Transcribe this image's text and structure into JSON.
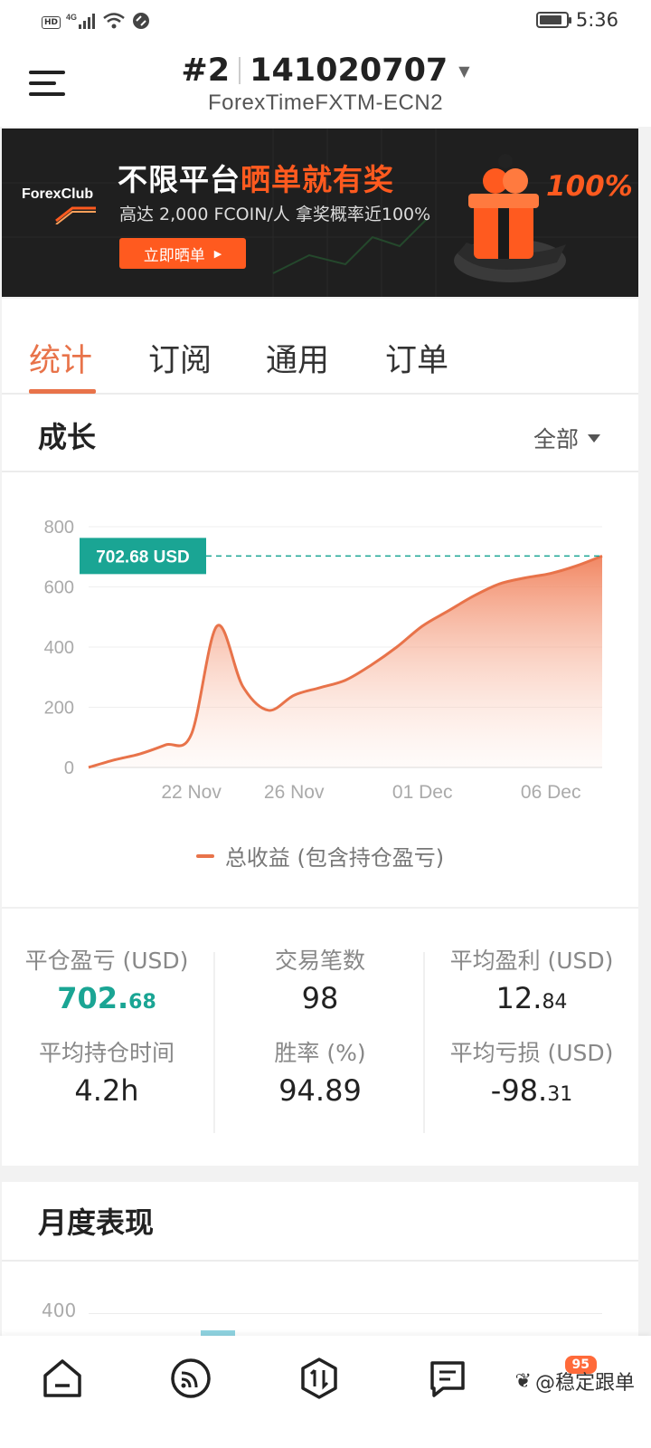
{
  "status_bar": {
    "network_badge": "HD",
    "signal": "4G",
    "time": "5:36",
    "battery_level": 0.85
  },
  "header": {
    "account_rank": "#2",
    "account_number": "141020707",
    "server": "ForexTimeFXTM-ECN2"
  },
  "banner": {
    "brand": "ForexClub",
    "title_plain": "不限平台",
    "title_highlight": "晒单就有奖",
    "subtitle": "高达 2,000 FCOIN/人  拿奖概率近100%",
    "cta": "立即晒单",
    "percent": "100%",
    "colors": {
      "accent": "#ff5a1f",
      "bg": "#1f1f1f"
    }
  },
  "tabs": [
    {
      "label": "统计",
      "active": true
    },
    {
      "label": "订阅",
      "active": false
    },
    {
      "label": "通用",
      "active": false
    },
    {
      "label": "订单",
      "active": false
    }
  ],
  "growth": {
    "title": "成长",
    "range_label": "全部"
  },
  "chart_data": {
    "type": "area",
    "title": "",
    "x_tick_labels": [
      "22 Nov",
      "26 Nov",
      "01 Dec",
      "06 Dec"
    ],
    "y_tick_labels": [
      "0",
      "200",
      "400",
      "600",
      "800"
    ],
    "ylim": [
      0,
      800
    ],
    "grid": true,
    "legend_position": "bottom",
    "series": [
      {
        "name": "总收益 (包含持仓盈亏)",
        "color": "#e8734a",
        "x": [
          "18 Nov",
          "19 Nov",
          "20 Nov",
          "21 Nov",
          "22 Nov",
          "23 Nov",
          "24 Nov",
          "25 Nov",
          "26 Nov",
          "27 Nov",
          "28 Nov",
          "29 Nov",
          "30 Nov",
          "01 Dec",
          "02 Dec",
          "03 Dec",
          "04 Dec",
          "05 Dec",
          "06 Dec",
          "07 Dec",
          "08 Dec"
        ],
        "y": [
          0,
          25,
          45,
          75,
          110,
          470,
          270,
          190,
          240,
          265,
          290,
          340,
          400,
          470,
          520,
          570,
          610,
          630,
          645,
          670,
          702.68
        ]
      }
    ],
    "annotation": {
      "label": "702.68 USD",
      "value": 702.68,
      "color": "#1aa594"
    }
  },
  "stats": {
    "closed_pnl": {
      "label": "平仓盈亏 (USD)",
      "int": "702.",
      "dec": "68"
    },
    "trades": {
      "label": "交易笔数",
      "value": "98"
    },
    "avg_profit": {
      "label": "平均盈利 (USD)",
      "int": "12.",
      "dec": "84"
    },
    "avg_hold": {
      "label": "平均持仓时间",
      "value": "4.2h"
    },
    "win_rate": {
      "label": "胜率 (%)",
      "value": "94.89"
    },
    "avg_loss": {
      "label": "平均亏损 (USD)",
      "int": "-98.",
      "dec": "31"
    }
  },
  "monthly": {
    "title": "月度表现",
    "first_tick": "400"
  },
  "bottom_nav": {
    "items": [
      "home-icon",
      "subscription-icon",
      "trade-icon",
      "orders-icon"
    ],
    "watermark": "@稳定跟单",
    "badge": "95"
  }
}
